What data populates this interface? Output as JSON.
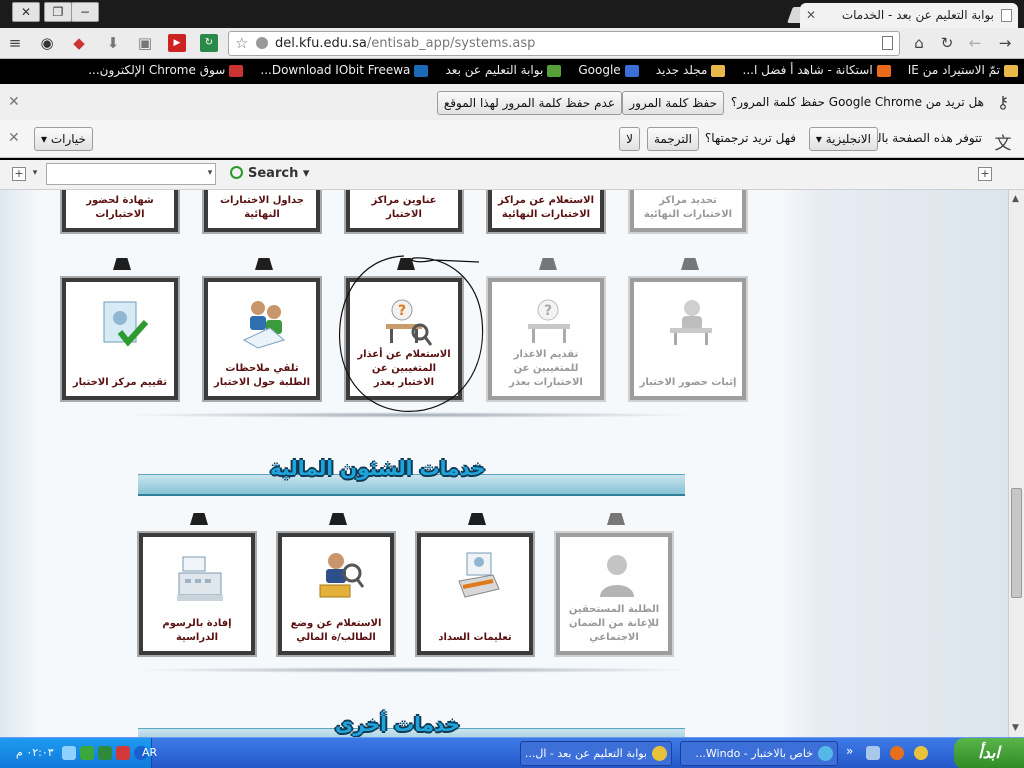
{
  "window": {
    "tab_title": "بوابة التعليم عن بعد - الخدمات"
  },
  "address_bar": {
    "url_host": "del.kfu.edu.sa",
    "url_path": "/entisab_app/systems.asp"
  },
  "bookmarks": [
    {
      "label": "تمّ الاستيراد من IE",
      "color": "#e8b84a"
    },
    {
      "label": "استكانة - شاهد أ فضل ا...",
      "color": "#e86a1a"
    },
    {
      "label": "مجلد جديد",
      "color": "#e8b84a"
    },
    {
      "label": "Google",
      "color": "#3a6fd8"
    },
    {
      "label": "بوابة التعليم عن بعد",
      "color": "#56a03a"
    },
    {
      "label": "Download IObit Freewa...",
      "color": "#1b6ab8"
    },
    {
      "label": "سوق Chrome الإلكترون...",
      "color": "#cc3333"
    }
  ],
  "password_bar": {
    "question": "هل تريد من Google Chrome حفظ كلمة المرور؟",
    "save_label": "حفظ كلمة المرور",
    "never_label": "عدم حفظ كلمة المرور لهذا الموقع"
  },
  "translate_bar": {
    "prefix": "تتوفر هذه الصفحة باللغة",
    "language": "الانجليزية",
    "question": "فهل تريد ترجمتها؟",
    "translate_label": "الترجمة",
    "no_label": "لا",
    "options_label": "خيارات"
  },
  "ext_toolbar": {
    "search_label": "Search"
  },
  "top_row": [
    {
      "label": "تحديد مراكز الاختبارات النهائية",
      "disabled": true
    },
    {
      "label": "الاستعلام عن مراكز الاختبارات النهائية",
      "disabled": false
    },
    {
      "label": "عناوين مراكز الاختبار",
      "disabled": false
    },
    {
      "label": "جداول الاختبارات النهائية",
      "disabled": false
    },
    {
      "label": "شهادة لحضور الاختبارات",
      "disabled": false
    }
  ],
  "exam_row": [
    {
      "label": "إثبات حضور الاختبار",
      "disabled": true
    },
    {
      "label": "تقديم الاعذار للمتغيبين عن الاختبارات بعذر",
      "disabled": true
    },
    {
      "label": "الاستعلام عن أعذار المتغيبين عن الاختبار بعذر",
      "disabled": false
    },
    {
      "label": "تلقي ملاحظات الطلبة حول الاختبار",
      "disabled": false
    },
    {
      "label": "تقييم مركز الاختبار",
      "disabled": false
    }
  ],
  "finance_section": {
    "title": "خدمات الشئون المالية"
  },
  "finance_row": [
    {
      "label": "الطلبة المستحقين للإعانة من الضمان الاجتماعي",
      "disabled": true
    },
    {
      "label": "تعليمات السداد",
      "disabled": false
    },
    {
      "label": "الاستعلام عن وضع الطالب/ة المالي",
      "disabled": false
    },
    {
      "label": "إفادة بالرسوم الدراسية",
      "disabled": false
    }
  ],
  "other_section": {
    "title": "خدمات أخرى"
  },
  "taskbar": {
    "start_label": "ابدأ",
    "tasks": [
      {
        "label": "خاص بالاختبار - Windo...",
        "color": "#56b8e8"
      },
      {
        "label": "بوابة التعليم عن بعد - ال...",
        "color": "#e8c23a"
      }
    ],
    "language": "AR",
    "clock": "٠٢:٠٣ م"
  },
  "colors": {
    "label_text": "#5a1010",
    "banner_text": "#1ea6dc",
    "taskbar": "#2458c9"
  }
}
